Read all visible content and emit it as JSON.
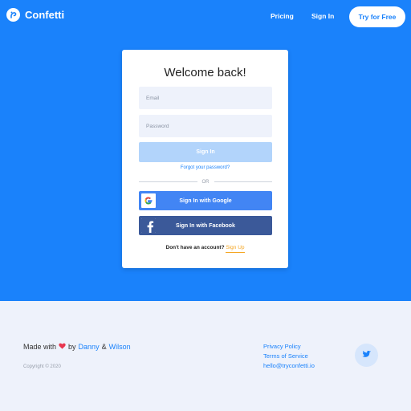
{
  "header": {
    "brand": "Confetti",
    "nav": [
      {
        "label": "Pricing"
      },
      {
        "label": "Sign In"
      }
    ],
    "cta_label": "Try for Free"
  },
  "login": {
    "title": "Welcome back!",
    "email_placeholder": "Email",
    "password_placeholder": "Password",
    "signin_label": "Sign In",
    "forgot_label": "Forgot your password?",
    "or_label": "OR",
    "google_label": "Sign In with Google",
    "facebook_label": "Sign In with Facebook",
    "no_account_label": "Don't have an account?",
    "signup_label": "Sign Up"
  },
  "footer": {
    "made_with": "Made with",
    "by": "by",
    "author1": "Danny",
    "amp": "&",
    "author2": "Wilson",
    "copyright": "Copyright © 2020",
    "links": [
      {
        "label": "Privacy Policy"
      },
      {
        "label": "Terms of Service"
      },
      {
        "label": "hello@tryconfetti.io"
      }
    ]
  },
  "icons": {
    "logo": "confetti-logo-icon",
    "google": "google-icon",
    "facebook": "facebook-icon",
    "heart": "heart-icon",
    "twitter": "twitter-icon"
  },
  "colors": {
    "primary": "#1a82fb",
    "signin_disabled": "#b2d4fb",
    "google": "#4285f4",
    "facebook": "#3b5999",
    "signup": "#f5a623",
    "heart": "#e8364f",
    "footer_bg": "#eef2fb"
  }
}
